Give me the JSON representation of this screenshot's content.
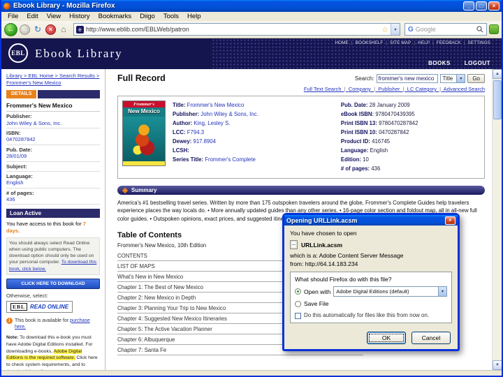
{
  "window": {
    "title": "Ebook Library - Mozilla Firefox",
    "menus": [
      "File",
      "Edit",
      "View",
      "History",
      "Bookmarks",
      "Diigo",
      "Tools",
      "Help"
    ],
    "url": "http://www.eblib.com/EBLWeb/patron",
    "search_engine_placeholder": "Google"
  },
  "icons": {
    "back": "←",
    "forward": "→",
    "refresh": "↻",
    "stop": "×",
    "home": "⌂",
    "star": "☆",
    "dropdown": "▾",
    "minimize": "_",
    "maximize": "□",
    "close": "×",
    "scroll_up": "▲",
    "scroll_down": "▼",
    "favicon_letter": "e",
    "google_g": "G",
    "info": "i"
  },
  "site": {
    "logo_short": "EBL",
    "logo_name": "Ebook  Library",
    "top_links": [
      "HOME",
      "BOOKSHELF",
      "SITE MAP",
      "HELP",
      "FEEDBACK",
      "SETTINGS"
    ],
    "books": "BOOKS",
    "logout": "LOGOUT"
  },
  "sidebar": {
    "breadcrumb": "Library > EBL Home > Search Results > Frommer's New Mexico",
    "details_tab": "DETAILS",
    "book_title": "Frommer's New Mexico",
    "fields": [
      {
        "label": "Publisher:",
        "value": "John Wiley & Sons, Inc."
      },
      {
        "label": "ISBN:",
        "value": "0470287842"
      },
      {
        "label": "Pub. Date:",
        "value": "28/01/09"
      },
      {
        "label": "Subject:",
        "value": ""
      },
      {
        "label": "Language:",
        "value": "English"
      },
      {
        "label": "# of pages:",
        "value": "436"
      }
    ],
    "loan_header": "Loan Active",
    "loan_text": "You have access to this book for ",
    "loan_days": "7 days.",
    "download_note_1": "You should always select Read Online when using public computers. The download option should only be used on your personal computer. ",
    "download_note_2": "To download this book, click below.",
    "download_button": "CLICK HERE TO DOWNLOAD",
    "otherwise": "Otherwise, select:",
    "ebl_mark": "EBL",
    "read_online": "READ ONLINE",
    "purchase_text": "This book is available for ",
    "purchase_link": "purchase here.",
    "note_label": "Note:",
    "note_1": " To download this e-book you must have Adobe Digital Editions installed. For downloading e-books, ",
    "note_hl": "Adobe Digital Editions is the required software.",
    "note_2": " Click here to check system requirements, and to download the software."
  },
  "main": {
    "heading": "Full Record",
    "search_label": "Search:",
    "search_value": "frommer's new mexico",
    "search_category": "Title",
    "go_button": "Go",
    "search_links": [
      "Full Text Search",
      "Company",
      "Publisher",
      "LC Category",
      "Advanced Search"
    ],
    "cover": {
      "brand": "Frommer's",
      "title": "New Mexico"
    },
    "record_left": [
      {
        "label": "Title:",
        "value": "Frommer's New Mexico"
      },
      {
        "label": "Publisher:",
        "value": "John Wiley & Sons, Inc."
      },
      {
        "label": "Author:",
        "value": "King, Lesley S."
      },
      {
        "label": "LCC:",
        "value": "F794.3"
      },
      {
        "label": "Dewey:",
        "value": "917.8904"
      },
      {
        "label": "LCSH:",
        "value": ""
      },
      {
        "label": "Series Title:",
        "value": "Frommer's Complete"
      }
    ],
    "record_right": [
      {
        "label": "Pub. Date:",
        "value": "28 January 2009"
      },
      {
        "label": "eBook ISBN:",
        "value": "9780470439395"
      },
      {
        "label": "Print ISBN 13:",
        "value": "9780470287842"
      },
      {
        "label": "Print ISBN 10:",
        "value": "0470287842"
      },
      {
        "label": "Product ID:",
        "value": "416745"
      },
      {
        "label": "Language:",
        "value": "English"
      },
      {
        "label": "Edition:",
        "value": "10"
      },
      {
        "label": "# of pages:",
        "value": "436"
      }
    ],
    "summary_header": "Summary",
    "summary_text": "America's #1 bestselling travel series. Written by more than 175 outspoken travelers around the globe, Frommer's Complete Guides help travelers experience places the way locals do. • More annually updated guides than any other series. • 16-page color section and foldout map, all in all-new full color guides. • Outspoken opinions, exact prices, and suggested itineraries. • Easy-to-read, two-column design.",
    "toc_header": "Table of Contents",
    "toc_subtitle": "Frommer's New Mexico, 10th Edition",
    "toc_items": [
      "CONTENTS",
      "LIST OF MAPS",
      "What's New in New Mexico",
      "Chapter 1: The Best of New Mexico",
      "Chapter 2: New Mexico in Depth",
      "Chapter 3: Planning Your Trip to New Mexico",
      "Chapter 4: Suggested New Mexico Itineraries",
      "Chapter 5: The Active Vacation Planner",
      "Chapter 6: Albuquerque",
      "Chapter 7: Santa Fe"
    ]
  },
  "dialog": {
    "title": "Opening URLLink.acsm",
    "intro": "You have chosen to open",
    "filename": "URLLink.acsm",
    "filetype": "which is a: Adobe Content Server Message",
    "from": "from: http://64.14.183.234",
    "question": "What should Firefox do with this file?",
    "open_with": "Open with",
    "open_with_value": "Adobe Digital Editions (default)",
    "save_file": "Save File",
    "auto_check": "Do this automatically for files like this from now on.",
    "ok": "OK",
    "cancel": "Cancel"
  }
}
